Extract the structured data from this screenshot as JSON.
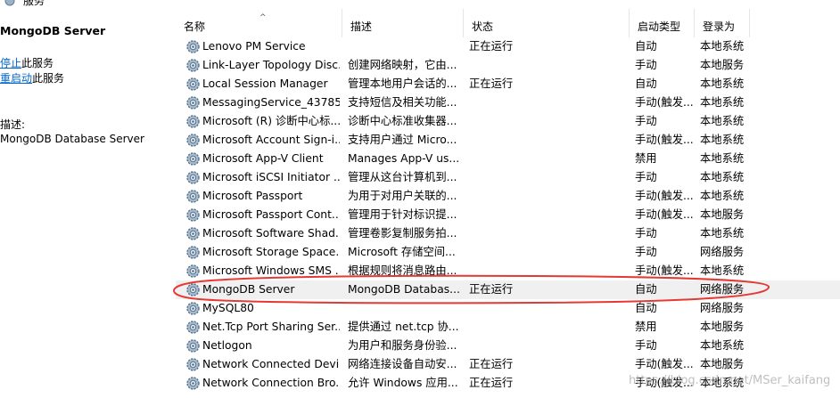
{
  "window": {
    "title": "服务"
  },
  "left_panel": {
    "service_name": "MongoDB Server",
    "stop_link": "停止",
    "stop_suffix": "此服务",
    "restart_link": "重启动",
    "restart_suffix": "此服务",
    "desc_label": "描述:",
    "desc_text": "MongoDB Database Server"
  },
  "columns": {
    "name": "名称",
    "description": "描述",
    "status": "状态",
    "startup_type": "启动类型",
    "logon_as": "登录为"
  },
  "services": [
    {
      "name": "Lenovo PM Service",
      "description": "",
      "status": "正在运行",
      "startup": "自动",
      "logon": "本地系统",
      "icon": "gear-icon"
    },
    {
      "name": "Link-Layer Topology Disc...",
      "description": "创建网络映射，它由...",
      "status": "",
      "startup": "手动",
      "logon": "本地服务",
      "icon": "gear-icon"
    },
    {
      "name": "Local Session Manager",
      "description": "管理本地用户会话的...",
      "status": "正在运行",
      "startup": "自动",
      "logon": "本地系统",
      "icon": "gear-icon"
    },
    {
      "name": "MessagingService_43785...",
      "description": "支持短信及相关功能...",
      "status": "",
      "startup": "手动(触发...",
      "logon": "本地系统",
      "icon": "gear-icon"
    },
    {
      "name": "Microsoft (R) 诊断中心标...",
      "description": "诊断中心标准收集器...",
      "status": "",
      "startup": "手动",
      "logon": "本地系统",
      "icon": "gear-icon"
    },
    {
      "name": "Microsoft Account Sign-i...",
      "description": "支持用户通过 Micro...",
      "status": "",
      "startup": "手动(触发...",
      "logon": "本地系统",
      "icon": "gear-icon"
    },
    {
      "name": "Microsoft App-V Client",
      "description": "Manages App-V us...",
      "status": "",
      "startup": "禁用",
      "logon": "本地系统",
      "icon": "gear-icon"
    },
    {
      "name": "Microsoft iSCSI Initiator ...",
      "description": "管理从这台计算机到...",
      "status": "",
      "startup": "手动",
      "logon": "本地系统",
      "icon": "gear-icon"
    },
    {
      "name": "Microsoft Passport",
      "description": "为用于对用户关联的...",
      "status": "",
      "startup": "手动(触发...",
      "logon": "本地系统",
      "icon": "gear-icon"
    },
    {
      "name": "Microsoft Passport Cont...",
      "description": "管理用于针对标识提...",
      "status": "",
      "startup": "手动(触发...",
      "logon": "本地服务",
      "icon": "gear-icon"
    },
    {
      "name": "Microsoft Software Shad...",
      "description": "管理卷影复制服务拍...",
      "status": "",
      "startup": "手动",
      "logon": "本地系统",
      "icon": "gear-icon"
    },
    {
      "name": "Microsoft Storage Space...",
      "description": "Microsoft 存储空间...",
      "status": "",
      "startup": "手动",
      "logon": "网络服务",
      "icon": "gear-icon"
    },
    {
      "name": "Microsoft Windows SMS ...",
      "description": "根据规则将消息路由...",
      "status": "",
      "startup": "手动(触发...",
      "logon": "本地系统",
      "icon": "gear-icon"
    },
    {
      "name": "MongoDB Server",
      "description": "MongoDB Databas...",
      "status": "正在运行",
      "startup": "自动",
      "logon": "网络服务",
      "icon": "gear-icon",
      "selected": true
    },
    {
      "name": "MySQL80",
      "description": "",
      "status": "",
      "startup": "自动",
      "logon": "网络服务",
      "icon": "gear-icon"
    },
    {
      "name": "Net.Tcp Port Sharing Ser...",
      "description": "提供通过 net.tcp 协...",
      "status": "",
      "startup": "禁用",
      "logon": "本地服务",
      "icon": "gear-icon"
    },
    {
      "name": "Netlogon",
      "description": "为用户和服务身份验...",
      "status": "",
      "startup": "手动",
      "logon": "本地系统",
      "icon": "gear-icon"
    },
    {
      "name": "Network Connected Devi...",
      "description": "网络连接设备自动安...",
      "status": "正在运行",
      "startup": "手动(触发...",
      "logon": "本地服务",
      "icon": "gear-icon"
    },
    {
      "name": "Network Connection Bro...",
      "description": "允许 Windows 应用...",
      "status": "正在运行",
      "startup": "手动(触发...",
      "logon": "本地系统",
      "icon": "gear-icon"
    }
  ],
  "annotation": {
    "color": "#e53935"
  },
  "watermark": "https://blog.csdn.net/MSer_kaifang"
}
